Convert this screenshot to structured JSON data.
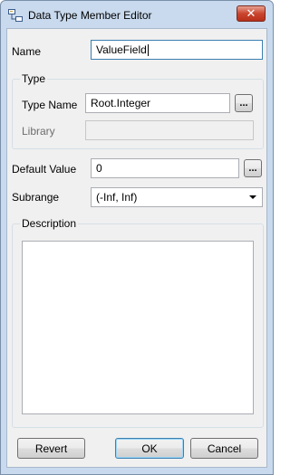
{
  "window": {
    "title": "Data Type Member Editor",
    "close_glyph": "✕"
  },
  "form": {
    "name_label": "Name",
    "name_value": "ValueField",
    "type_group_label": "Type",
    "type_name_label": "Type Name",
    "type_name_value": "Root.Integer",
    "type_browse_label": "...",
    "library_label": "Library",
    "library_value": "",
    "default_value_label": "Default Value",
    "default_value": "0",
    "default_browse_label": "...",
    "subrange_label": "Subrange",
    "subrange_value": "(-Inf, Inf)",
    "description_group_label": "Description",
    "description_value": ""
  },
  "buttons": {
    "revert": "Revert",
    "ok": "OK",
    "cancel": "Cancel"
  },
  "icons": {
    "app": "data-type-member-icon",
    "close": "close-icon",
    "dropdown": "chevron-down-icon"
  },
  "colors": {
    "titlebar": "#c9daee",
    "close_button": "#c9452e",
    "dialog_bg": "#f0f0f0",
    "focus_border": "#3c7fb1"
  }
}
